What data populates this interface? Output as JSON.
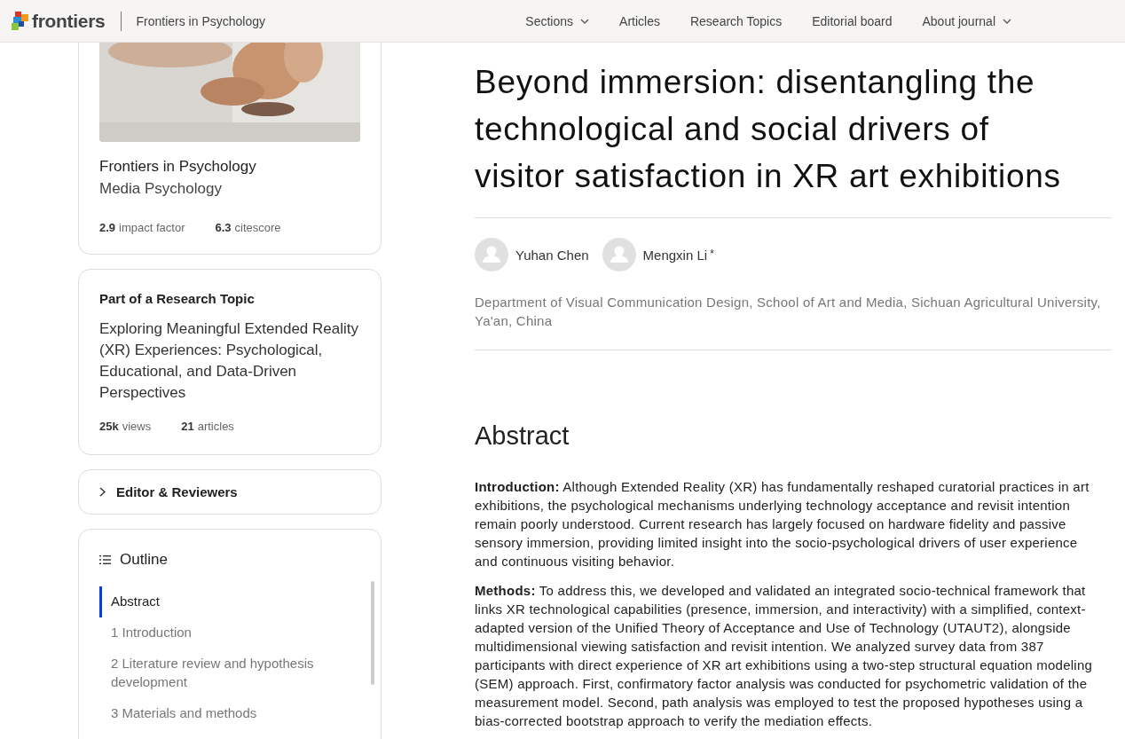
{
  "header": {
    "logo": "frontiers",
    "journal": "Frontiers in Psychology",
    "nav": [
      {
        "label": "Sections",
        "dropdown": true
      },
      {
        "label": "Articles",
        "dropdown": false
      },
      {
        "label": "Research Topics",
        "dropdown": false
      },
      {
        "label": "Editorial board",
        "dropdown": false
      },
      {
        "label": "About journal",
        "dropdown": true
      }
    ]
  },
  "journal_card": {
    "journal": "Frontiers in Psychology",
    "section": "Media Psychology",
    "metrics": [
      {
        "value": "2.9",
        "label": "impact factor"
      },
      {
        "value": "6.3",
        "label": "citescore"
      }
    ]
  },
  "topic_card": {
    "heading": "Part of a Research Topic",
    "title": "Exploring Meaningful Extended Reality (XR) Experiences: Psychological, Educational, and Data-Driven Perspectives",
    "metrics": [
      {
        "value": "25k",
        "label": "views"
      },
      {
        "value": "21",
        "label": "articles"
      }
    ]
  },
  "editors": {
    "label": "Editor & Reviewers",
    "expanded": false
  },
  "outline": {
    "title": "Outline",
    "items": [
      {
        "label": "Abstract",
        "selected": true
      },
      {
        "label": "1 Introduction",
        "selected": false
      },
      {
        "label": "2 Literature review and hypothesis development",
        "selected": false
      },
      {
        "label": "3 Materials and methods",
        "selected": false
      }
    ]
  },
  "article": {
    "title": "Beyond immersion: disentangling the technological and social drivers of visitor satisfaction in XR art exhibitions",
    "authors": [
      {
        "name": "Yuhan Chen"
      },
      {
        "name": "Mengxin Li",
        "mark": "*"
      }
    ],
    "affiliation": "Department of Visual Communication Design, School of Art and Media, Sichuan Agricultural University, Ya'an, China",
    "abstract_heading": "Abstract",
    "abstract": [
      "**Introduction:** Although Extended Reality (XR) has fundamentally reshaped curatorial practices in art exhibitions, the psychological mechanisms underlying technology acceptance and revisit intention remain poorly understood. Current research has largely focused on hardware fidelity and passive sensory immersion, providing limited insight into the socio-psychological drivers of user experience and continuous visiting behavior.",
      "**Methods:** To address this, we developed and validated an integrated socio-technical framework that links XR technological capabilities (presence, immersion, and interactivity) with a simplified, context-adapted version of the Unified Theory of Acceptance and Use of Technology (UTAUT2), alongside multidimensional viewing satisfaction and revisit intention. We analyzed survey data from 387 participants with direct experience of XR art exhibitions using a two-step structural equation modeling (SEM) approach. First, confirmatory factor analysis was conducted for psychometric validation of the measurement model. Second, path analysis was employed to test the proposed hypotheses using a bias-corrected bootstrap approach to verify the mediation effects."
    ]
  }
}
